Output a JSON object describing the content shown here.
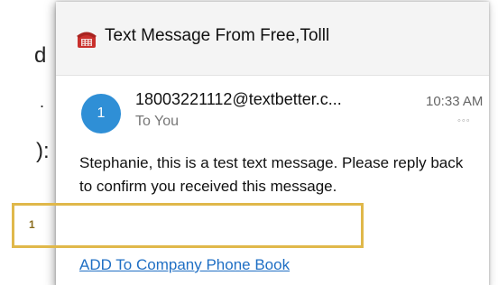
{
  "background": {
    "partial_text_1": "d",
    "partial_text_2": ".",
    "partial_text_3": "):"
  },
  "header": {
    "icon": "telephone-icon",
    "title": "Text Message From Free,Tolll"
  },
  "message": {
    "avatar_number": "1",
    "sender": "18003221112@textbetter.c...",
    "recipient": "To You",
    "time": "10:33 AM",
    "more_icon": "◦◦◦",
    "body": "Stephanie, this is a test text message. Please reply back to confirm you received this message.",
    "link": "ADD To Company Phone Book"
  },
  "annotation": {
    "label": "1",
    "color": "#e0b84a"
  }
}
